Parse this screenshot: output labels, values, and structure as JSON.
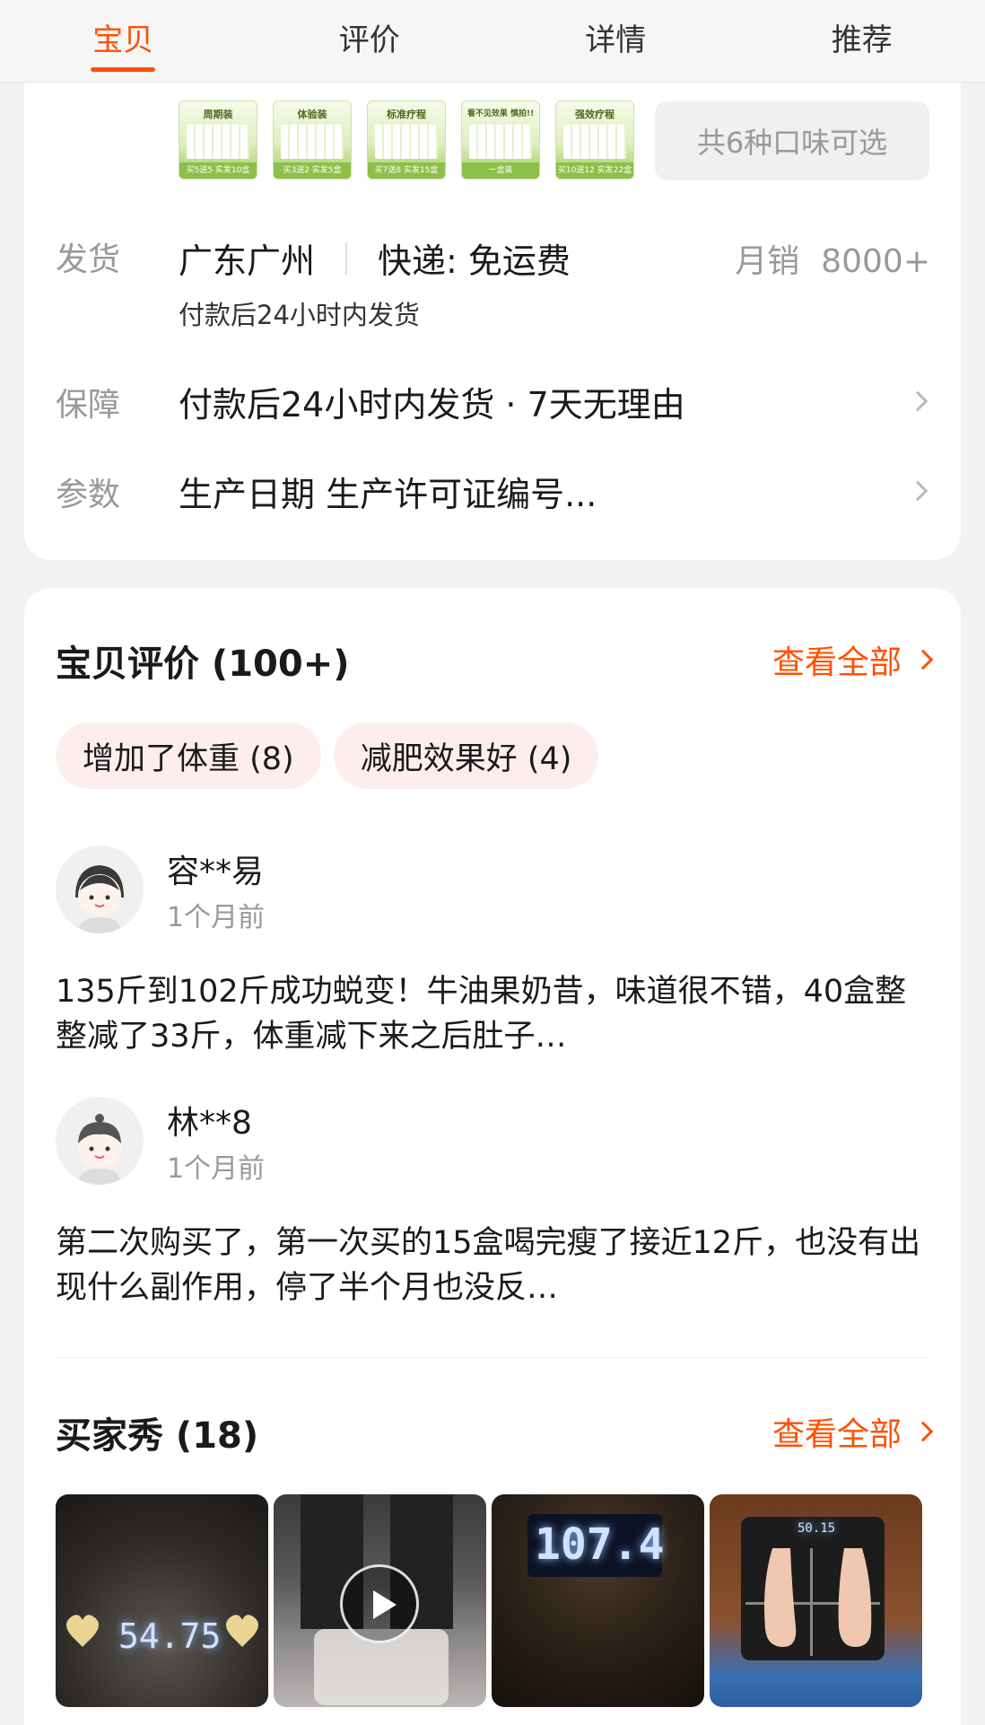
{
  "tabs": [
    {
      "label": "宝贝",
      "active": true
    },
    {
      "label": "评价",
      "active": false
    },
    {
      "label": "详情",
      "active": false
    },
    {
      "label": "推荐",
      "active": false
    }
  ],
  "sku_thumbs": [
    {
      "title": "周期装",
      "foot": "买5送5 实发10盒"
    },
    {
      "title": "体验装",
      "foot": "买3送2 实发5盒"
    },
    {
      "title": "标准疗程",
      "foot": "买7送8 实发15盒"
    },
    {
      "title": "看不见效果 慎拍!!",
      "foot": "一盒装"
    },
    {
      "title": "强效疗程",
      "foot": "买10送12 实发22盒"
    }
  ],
  "flavor_button": "共6种口味可选",
  "shipping": {
    "label": "发货",
    "location": "广东广州",
    "express": "快递: 免运费",
    "sales_label": "月销",
    "sales_value": "8000+",
    "note": "付款后24小时内发货"
  },
  "guarantee": {
    "label": "保障",
    "text": "付款后24小时内发货 · 7天无理由"
  },
  "params": {
    "label": "参数",
    "text": "生产日期 生产许可证编号..."
  },
  "reviews_section": {
    "title": "宝贝评价 (100+)",
    "view_all": "查看全部",
    "tags": [
      "增加了体重 (8)",
      "减肥效果好 (4)"
    ],
    "items": [
      {
        "user": "容**易",
        "time": "1个月前",
        "text": "135斤到102斤成功蜕变！牛油果奶昔，味道很不错，40盒整整减了33斤，体重减下来之后肚子…"
      },
      {
        "user": "林**8",
        "time": "1个月前",
        "text": "第二次购买了，第一次买的15盒喝完瘦了接近12斤，也没有出现什么副作用，停了半个月也没反…"
      }
    ]
  },
  "buyer_show": {
    "title": "买家秀 (18)",
    "view_all": "查看全部",
    "photos": [
      {
        "readout": "54.75"
      },
      {
        "readout": ""
      },
      {
        "readout": "107.4"
      },
      {
        "readout": "50.15"
      }
    ]
  },
  "colors": {
    "accent": "#ff5000",
    "tag_bg": "#fdeeed",
    "muted": "#999999"
  }
}
